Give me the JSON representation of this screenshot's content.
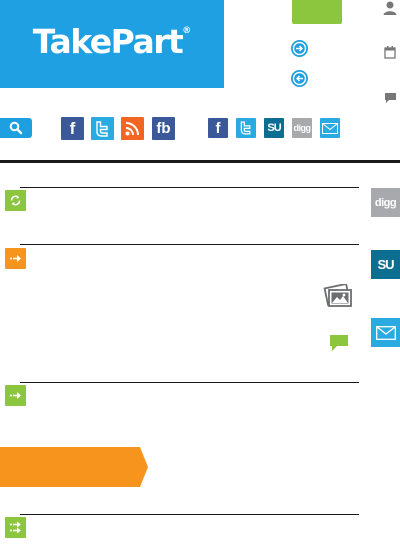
{
  "brand": {
    "logo_text": "TakePart",
    "logo_reg": "®",
    "color": "#1ea0e3"
  },
  "colors": {
    "accent_green": "#8cc63f",
    "accent_orange": "#f7941d",
    "facebook": "#3b5998",
    "twitter": "#29abe2",
    "rss": "#f26522",
    "stumbleupon": "#0c6f91",
    "digg": "#a7a9ac"
  },
  "follow_icons": [
    {
      "name": "facebook-icon",
      "text": "f"
    },
    {
      "name": "twitter-icon",
      "text": "t"
    },
    {
      "name": "rss-icon",
      "text": ""
    },
    {
      "name": "facebook-page-icon",
      "text": "fb"
    }
  ],
  "share_icons": [
    {
      "name": "facebook-share-icon",
      "text": "f"
    },
    {
      "name": "twitter-share-icon",
      "text": "t"
    },
    {
      "name": "stumbleupon-share-icon",
      "text": "SU"
    },
    {
      "name": "digg-share-icon",
      "text": "digg"
    },
    {
      "name": "email-share-icon",
      "text": ""
    }
  ],
  "rail": {
    "digg_label": "digg",
    "stumbleupon_label": "SU"
  }
}
